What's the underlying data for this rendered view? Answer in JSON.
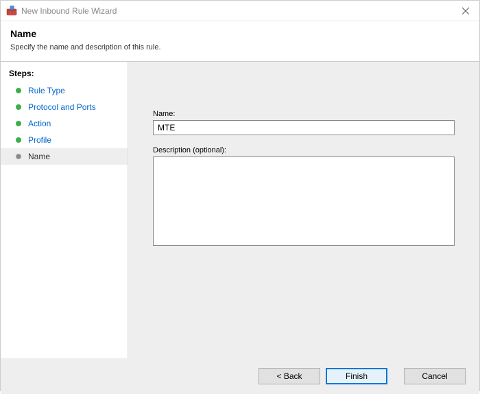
{
  "window": {
    "title": "New Inbound Rule Wizard"
  },
  "header": {
    "title": "Name",
    "subtitle": "Specify the name and description of this rule."
  },
  "sidebar": {
    "heading": "Steps:",
    "items": [
      {
        "label": "Rule Type"
      },
      {
        "label": "Protocol and Ports"
      },
      {
        "label": "Action"
      },
      {
        "label": "Profile"
      },
      {
        "label": "Name"
      }
    ]
  },
  "form": {
    "name_label": "Name:",
    "name_value": "MTE",
    "desc_label": "Description (optional):",
    "desc_value": ""
  },
  "buttons": {
    "back": "< Back",
    "finish": "Finish",
    "cancel": "Cancel"
  }
}
